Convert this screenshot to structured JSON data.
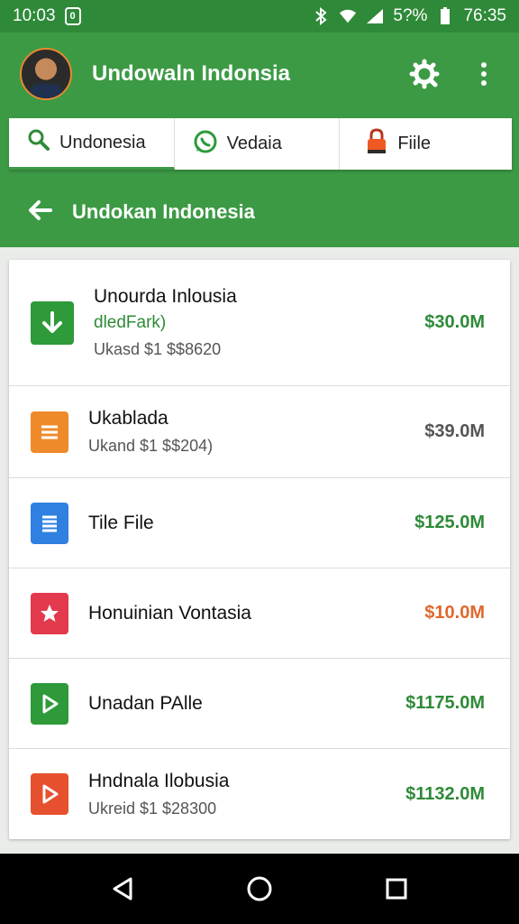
{
  "status_bar": {
    "time": "10:03",
    "badge": "0",
    "battery": "5?%",
    "clock_right": "76:35"
  },
  "app_bar": {
    "title": "Undowaln Indonsia",
    "icons": [
      "avatar",
      "search-icon",
      "more-vert-icon"
    ]
  },
  "tabs": [
    {
      "label": "Undonesia",
      "icon": "search-icon"
    },
    {
      "label": "Vedaia",
      "icon": "whatsapp-icon"
    },
    {
      "label": "Fiile",
      "icon": "lock-icon"
    }
  ],
  "sub_header": {
    "title": "Undokan Indonesia",
    "icon": "arrow-back-icon"
  },
  "items": [
    {
      "title": "Unourda Inlousia",
      "subtitle": "dledFark)",
      "meta": "Ukasd $1 $$8620",
      "amount": "$30.0M",
      "amount_color": "#2e8a38",
      "icon": "download-icon",
      "icon_color": "#2e9a3a"
    },
    {
      "title": "Ukablada",
      "subtitle": "",
      "meta": "Ukand $1 $$204)",
      "amount": "$39.0M",
      "amount_color": "#555555",
      "icon": "document-icon",
      "icon_color": "#ef8a2a"
    },
    {
      "title": "Tile File",
      "subtitle": "",
      "meta": "",
      "amount": "$125.0M",
      "amount_color": "#2e8a38",
      "icon": "doc-file-icon",
      "icon_color": "#2f80e0"
    },
    {
      "title": "Honuinian Vontasia",
      "subtitle": "",
      "meta": "",
      "amount": "$10.0M",
      "amount_color": "#e0682e",
      "icon": "star-icon",
      "icon_color": "#e23a4c"
    },
    {
      "title": "Unadan PAlle",
      "subtitle": "",
      "meta": "",
      "amount": "$1175.0M",
      "amount_color": "#2e8a38",
      "icon": "play-icon",
      "icon_color": "#2e9a3a"
    },
    {
      "title": "Hndnala Ilobusia",
      "subtitle": "",
      "meta": "Ukreid $1 $28300",
      "amount": "$1132.0M",
      "amount_color": "#2e8a38",
      "icon": "play-icon",
      "icon_color": "#e6502e"
    }
  ],
  "nav_bar": {
    "icons": [
      "back-triangle-icon",
      "home-circle-icon",
      "recents-square-icon"
    ]
  },
  "colors": {
    "primary": "#3c9a45",
    "primary_dark": "#2e8a38"
  }
}
